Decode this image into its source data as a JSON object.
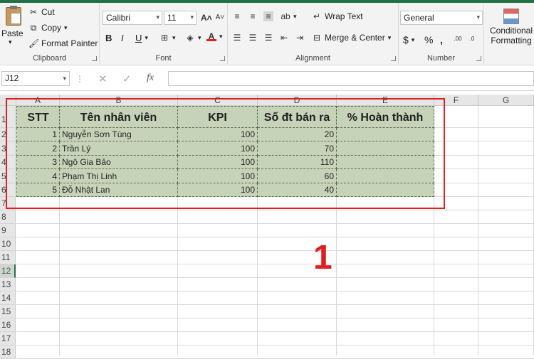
{
  "ribbon": {
    "clipboard": {
      "paste": "Paste",
      "cut": "Cut",
      "copy": "Copy",
      "format_painter": "Format Painter",
      "label": "Clipboard"
    },
    "font": {
      "name": "Calibri",
      "size": "11",
      "bold": "B",
      "italic": "I",
      "underline": "U",
      "label": "Font",
      "font_color": "#e02020"
    },
    "alignment": {
      "wrap_text": "Wrap Text",
      "merge_center": "Merge & Center",
      "label": "Alignment"
    },
    "number": {
      "format": "General",
      "currency": "$",
      "percent": "%",
      "comma": ",",
      "label": "Number"
    },
    "styles": {
      "conditional_formatting": "Conditional Formatting"
    }
  },
  "formula_bar": {
    "cell_ref": "J12",
    "fx": "fx"
  },
  "sheet": {
    "columns": [
      "A",
      "B",
      "C",
      "D",
      "E",
      "F",
      "G"
    ],
    "rows": [
      "1",
      "2",
      "3",
      "4",
      "5",
      "6",
      "7",
      "8",
      "9",
      "10",
      "11",
      "12",
      "13",
      "14",
      "15",
      "16",
      "17",
      "18"
    ],
    "selected_row": "12",
    "table": {
      "headers": [
        "STT",
        "Tên nhân viên",
        "KPI",
        "Số đt bán ra",
        "% Hoàn thành"
      ],
      "rows": [
        [
          "1",
          "Nguyễn Sơn Tùng",
          "100",
          "20",
          ""
        ],
        [
          "2",
          "Trần Lý",
          "100",
          "70",
          ""
        ],
        [
          "3",
          "Ngô Gia Bảo",
          "100",
          "110",
          ""
        ],
        [
          "4",
          "Phạm Thị Linh",
          "100",
          "60",
          ""
        ],
        [
          "5",
          "Đỗ Nhật Lan",
          "100",
          "40",
          ""
        ]
      ]
    }
  },
  "annotation": {
    "step": "1",
    "color": "#e02020"
  },
  "colors": {
    "accent": "#217346",
    "table_fill": "#c7d3b8"
  }
}
